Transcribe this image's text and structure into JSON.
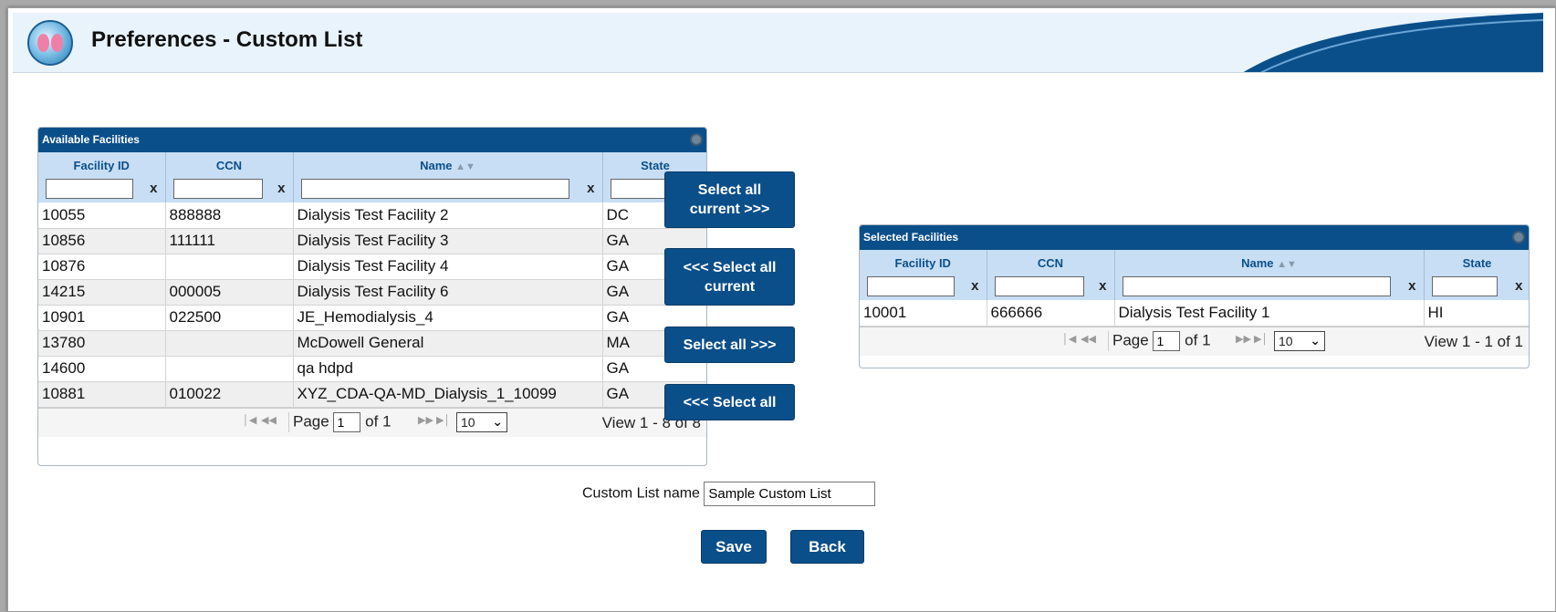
{
  "header": {
    "title": "Preferences - Custom List"
  },
  "available": {
    "caption": "Available Facilities",
    "columns": [
      "Facility ID",
      "CCN",
      "Name",
      "State"
    ],
    "clear_label": "x",
    "rows": [
      [
        "10055",
        "888888",
        "Dialysis Test Facility 2",
        "DC"
      ],
      [
        "10856",
        "111111",
        "Dialysis Test Facility 3",
        "GA"
      ],
      [
        "10876",
        "",
        "Dialysis Test Facility 4",
        "GA"
      ],
      [
        "14215",
        "000005",
        "Dialysis Test Facility 6",
        "GA"
      ],
      [
        "10901",
        "022500",
        "JE_Hemodialysis_4",
        "GA"
      ],
      [
        "13780",
        "",
        "McDowell General",
        "MA"
      ],
      [
        "14600",
        "",
        "qa hdpd",
        "GA"
      ],
      [
        "10881",
        "010022",
        "XYZ_CDA-QA-MD_Dialysis_1_10099",
        "GA"
      ]
    ],
    "pager": {
      "page_label": "Page",
      "page": "1",
      "of": "of 1",
      "rows_per_page": "10",
      "view": "View 1 - 8 of 8"
    }
  },
  "selected": {
    "caption": "Selected Facilities",
    "columns": [
      "Facility ID",
      "CCN",
      "Name",
      "State"
    ],
    "clear_label": "x",
    "rows": [
      [
        "10001",
        "666666",
        "Dialysis Test Facility 1",
        "HI"
      ]
    ],
    "pager": {
      "page_label": "Page",
      "page": "1",
      "of": "of 1",
      "rows_per_page": "10",
      "view": "View 1 - 1 of 1"
    }
  },
  "buttons": {
    "select_all_current_right": [
      "Select all",
      "current >>>"
    ],
    "select_all_current_left": [
      "<<< Select all",
      "current"
    ],
    "select_all_right": "Select all >>>",
    "select_all_left": "<<< Select all",
    "save": "Save",
    "back": "Back"
  },
  "custom_list": {
    "label": "Custom List name",
    "value": "Sample Custom List"
  },
  "icons": {
    "logo": "kidney-logo-icon",
    "gear": "gear-icon",
    "sort": "sort-icon",
    "first": "first-page-icon",
    "prev": "prev-page-icon",
    "next": "next-page-icon",
    "last": "last-page-icon",
    "dropdown": "chevron-down-icon"
  },
  "colors": {
    "brand": "#0b4f8a",
    "header_bg": "#e8f3fc",
    "column_header_bg": "#c7def5"
  }
}
